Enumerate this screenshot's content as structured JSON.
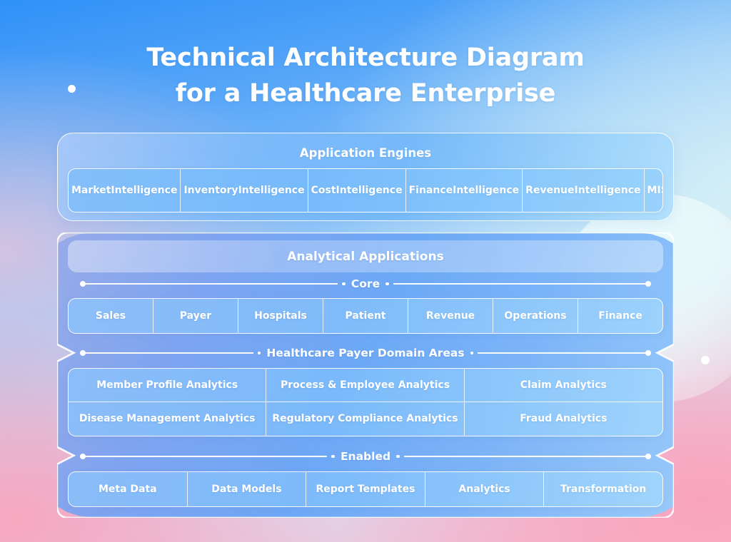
{
  "title": {
    "line1": "Technical Architecture Diagram",
    "line2": "for a Healthcare Enterprise"
  },
  "colors": {
    "accent_blue": "#4a9bf7",
    "panel_white": "#ffffff",
    "bg_pink": "#f9a4bd",
    "bg_cyan": "#d9f2f6",
    "bg_blue": "#2f91f7"
  },
  "engines": {
    "heading": "Application Engines",
    "cells": [
      "Market\nIntelligence",
      "Inventory\nIntelligence",
      "Cost\nIntelligence",
      "Finance\nIntelligence",
      "Revenue\nIntelligence",
      "MIS\nDashboard"
    ]
  },
  "analytical": {
    "heading": "Analytical Applications",
    "sections": [
      {
        "divider_label": "Core",
        "cells": [
          "Sales",
          "Payer",
          "Hospitals",
          "Patient",
          "Revenue",
          "Operations",
          "Finance"
        ]
      },
      {
        "divider_label": "Healthcare Payer Domain Areas",
        "cells": [
          "Member Profile Analytics",
          "Process & Employee Analytics",
          "Claim Analytics",
          "Disease Management Analytics",
          "Regulatory Compliance Analytics",
          "Fraud Analytics"
        ]
      },
      {
        "divider_label": "Enabled",
        "cells": [
          "Meta Data",
          "Data Models",
          "Report Templates",
          "Analytics",
          "Transformation"
        ]
      }
    ]
  }
}
